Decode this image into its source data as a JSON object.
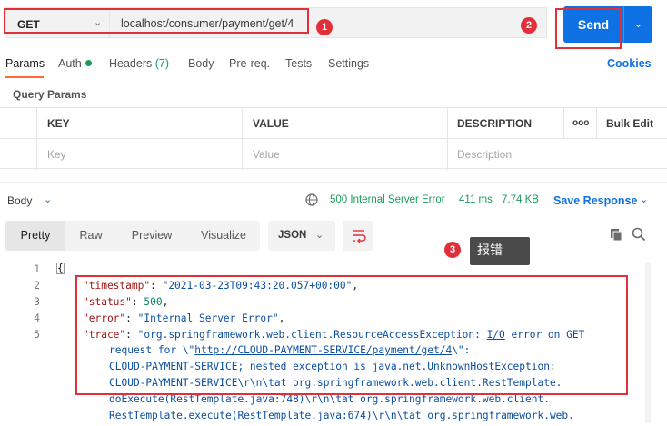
{
  "request": {
    "method": "GET",
    "url": "localhost/consumer/payment/get/4",
    "send_label": "Send"
  },
  "annotations": {
    "badge_1": "1",
    "badge_2": "2",
    "badge_3": "3",
    "note": "报错"
  },
  "tabs": {
    "params": "Params",
    "auth": "Auth",
    "headers": "Headers",
    "headers_count": "(7)",
    "body": "Body",
    "prereq": "Pre-req.",
    "tests": "Tests",
    "settings": "Settings",
    "cookies": "Cookies"
  },
  "query_params": {
    "title": "Query Params",
    "headers": {
      "key": "KEY",
      "value": "VALUE",
      "description": "DESCRIPTION",
      "more": "ooo",
      "bulk_edit": "Bulk Edit"
    },
    "placeholders": {
      "key": "Key",
      "value": "Value",
      "description": "Description"
    }
  },
  "response": {
    "body_label": "Body",
    "status": "500 Internal Server Error",
    "time": "411 ms",
    "size": "7.74 KB",
    "save_label": "Save Response",
    "views": [
      "Pretty",
      "Raw",
      "Preview",
      "Visualize"
    ],
    "active_view": "Pretty",
    "format": "JSON",
    "line_numbers": [
      "1",
      "2",
      "3",
      "4",
      "5"
    ],
    "code": {
      "timestamp_key": "\"timestamp\"",
      "timestamp_val": "\"2021-03-23T09:43:20.057+00:00\"",
      "status_key": "\"status\"",
      "status_val": "500",
      "error_key": "\"error\"",
      "error_val": "\"Internal Server Error\"",
      "trace_key": "\"trace\"",
      "trace_l1_a": "\"org.springframework.web.client.ResourceAccessException: ",
      "trace_l1_io": "I/O",
      "trace_l1_b": " error on GET",
      "trace_l2_a": "request for \\\"",
      "trace_l2_link": "http://CLOUD-PAYMENT-SERVICE/payment/get/4",
      "trace_l2_b": "\\\":",
      "trace_l3": "CLOUD-PAYMENT-SERVICE; nested exception is java.net.UnknownHostException:",
      "trace_l4": "CLOUD-PAYMENT-SERVICE\\r\\n\\tat org.springframework.web.client.RestTemplate.",
      "trace_l5": "doExecute(RestTemplate.java:748)\\r\\n\\tat org.springframework.web.client.",
      "trace_l6": "RestTemplate.execute(RestTemplate.java:674)\\r\\n\\tat org.springframework.web."
    }
  },
  "colors": {
    "accent_blue": "#0e72e5",
    "status_green": "#1a9c5b",
    "annotation_red": "#e0303a",
    "tab_underline": "#ff6c37"
  }
}
